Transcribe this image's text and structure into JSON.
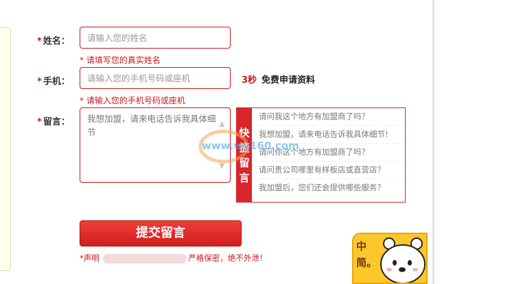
{
  "form": {
    "name": {
      "label": "姓名：",
      "required_mark": "*",
      "placeholder": "请输入您的姓名",
      "hint": "* 请填写您的真实姓名"
    },
    "phone": {
      "label": "手机：",
      "required_mark": "*",
      "placeholder": "请输入您的手机号码或座机",
      "hint": "* 请输入您的手机号码或座机"
    },
    "message": {
      "label": "留言：",
      "required_mark": "*",
      "value": "我想加盟，请来电话告诉我具体细节"
    },
    "promo": {
      "seconds": "3秒",
      "text": "免费申请资料"
    },
    "quick_messages": {
      "tab_label": "快捷留言",
      "items": [
        "请问我这个地方有加盟商了吗？",
        "我想加盟，请来电话告诉我具体细节!",
        "请问你这个地方有加盟商了吗？",
        "请问贵公司哪里有样板店或直营店？",
        "我加盟后，您们还会提供哪些服务？"
      ]
    },
    "submit_label": "提交留言",
    "declaration": {
      "prefix": "*声明",
      "suffix": "严格保密，绝不外泄！"
    }
  },
  "watermark": {
    "url": "www.wy160.com"
  },
  "mascot": {
    "text": "中简。"
  },
  "colors": {
    "accent_red": "#c8161d",
    "quick_red": "#d9262c",
    "mascot_yellow": "#fbc72b"
  }
}
